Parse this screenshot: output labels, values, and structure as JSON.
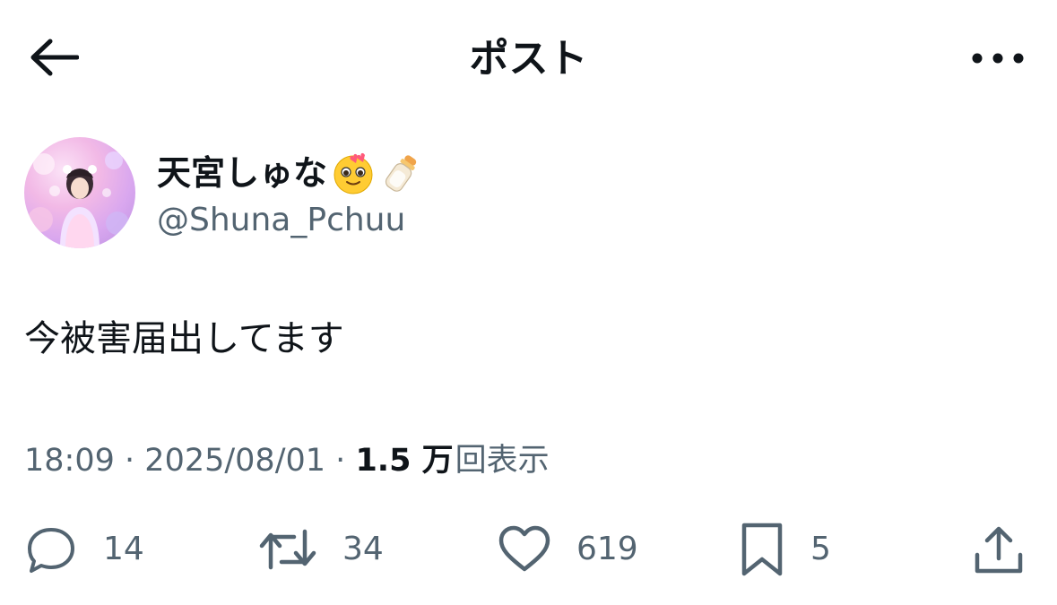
{
  "header": {
    "title": "ポスト"
  },
  "author": {
    "display_name": "天宮しゅな",
    "name_emojis": [
      "smiling-face-with-hearts-icon",
      "baby-bottle-icon"
    ],
    "handle": "@Shuna_Pchuu"
  },
  "tweet": {
    "text": "今被害届出してます"
  },
  "meta": {
    "time": "18:09",
    "separator": "·",
    "date": "2025/08/01",
    "views_count": "1.5 万",
    "views_label": "回表示"
  },
  "actions": {
    "replies": "14",
    "reposts": "34",
    "likes": "619",
    "bookmarks": "5"
  },
  "colors": {
    "text_primary": "#0f1419",
    "text_secondary": "#536471",
    "background": "#ffffff"
  }
}
